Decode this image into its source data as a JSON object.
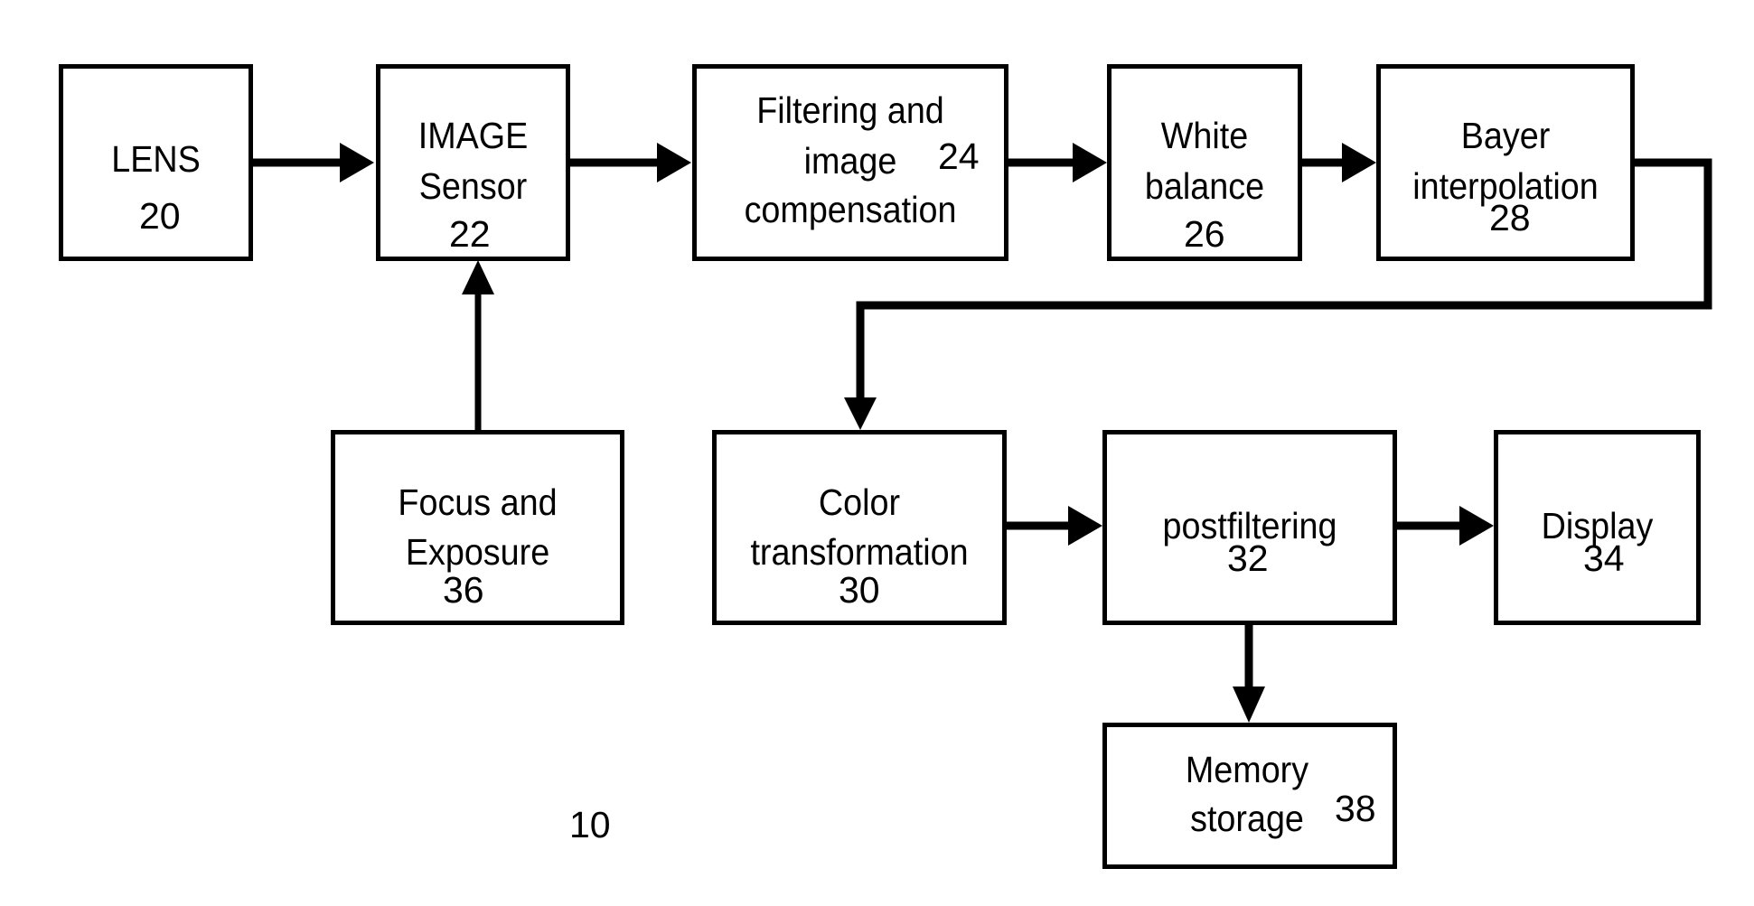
{
  "figure": {
    "reference_number": "10",
    "blocks": [
      {
        "id": "lens",
        "lines": [
          "LENS"
        ],
        "number": "20"
      },
      {
        "id": "image-sensor",
        "lines": [
          "IMAGE",
          "Sensor"
        ],
        "number": "22"
      },
      {
        "id": "filtering",
        "lines": [
          "Filtering and",
          "image",
          "compensation"
        ],
        "number": "24"
      },
      {
        "id": "white-balance",
        "lines": [
          "White",
          "balance"
        ],
        "number": "26"
      },
      {
        "id": "bayer",
        "lines": [
          "Bayer",
          "interpolation"
        ],
        "number": "28"
      },
      {
        "id": "color-transform",
        "lines": [
          "Color",
          "transformation"
        ],
        "number": "30"
      },
      {
        "id": "postfiltering",
        "lines": [
          "postfiltering"
        ],
        "number": "32"
      },
      {
        "id": "display",
        "lines": [
          "Display"
        ],
        "number": "34"
      },
      {
        "id": "focus-exposure",
        "lines": [
          "Focus and",
          "Exposure"
        ],
        "number": "36"
      },
      {
        "id": "memory",
        "lines": [
          "Memory",
          "storage"
        ],
        "number": "38"
      }
    ],
    "connections": [
      {
        "from": "lens",
        "to": "image-sensor"
      },
      {
        "from": "image-sensor",
        "to": "filtering"
      },
      {
        "from": "filtering",
        "to": "white-balance"
      },
      {
        "from": "white-balance",
        "to": "bayer"
      },
      {
        "from": "bayer",
        "to": "color-transform"
      },
      {
        "from": "color-transform",
        "to": "postfiltering"
      },
      {
        "from": "postfiltering",
        "to": "display"
      },
      {
        "from": "postfiltering",
        "to": "memory"
      },
      {
        "from": "focus-exposure",
        "to": "image-sensor"
      }
    ]
  }
}
